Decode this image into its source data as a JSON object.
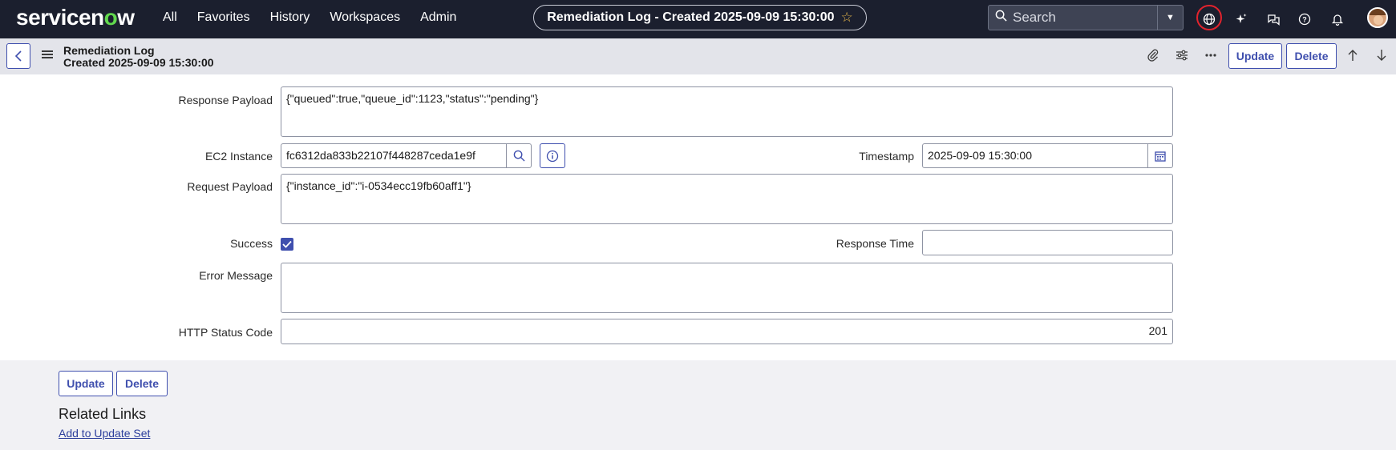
{
  "topnav": {
    "logo_text": "servicenow",
    "links": [
      "All",
      "Favorites",
      "History",
      "Workspaces",
      "Admin"
    ],
    "record_pill": "Remediation Log - Created 2025-09-09 15:30:00",
    "search_placeholder": "Search",
    "icons": [
      "globe-icon",
      "sparkle-icon",
      "chat-icon",
      "help-icon",
      "bell-icon",
      "avatar"
    ]
  },
  "header": {
    "title_line1": "Remediation Log",
    "title_line2": "Created 2025-09-09 15:30:00",
    "update_label": "Update",
    "delete_label": "Delete"
  },
  "form": {
    "response_payload": {
      "label": "Response Payload",
      "value": "{\"queued\":true,\"queue_id\":1123,\"status\":\"pending\"}"
    },
    "ec2_instance": {
      "label": "EC2 Instance",
      "value": "fc6312da833b22107f448287ceda1e9f"
    },
    "timestamp": {
      "label": "Timestamp",
      "value": "2025-09-09 15:30:00"
    },
    "request_payload": {
      "label": "Request Payload",
      "value": "{\"instance_id\":\"i-0534ecc19fb60aff1\"}"
    },
    "success": {
      "label": "Success",
      "checked": true
    },
    "response_time": {
      "label": "Response Time",
      "value": ""
    },
    "error_message": {
      "label": "Error Message",
      "value": ""
    },
    "http_status_code": {
      "label": "HTTP Status Code",
      "value": "201"
    }
  },
  "bottom": {
    "update_label": "Update",
    "delete_label": "Delete",
    "related_links_title": "Related Links",
    "related_links": [
      "Add to Update Set"
    ]
  },
  "colors": {
    "nav_bg": "#1b1f2e",
    "accent": "#3f4fae",
    "logo_green": "#62d84e",
    "focus_ring": "#e2232d"
  }
}
